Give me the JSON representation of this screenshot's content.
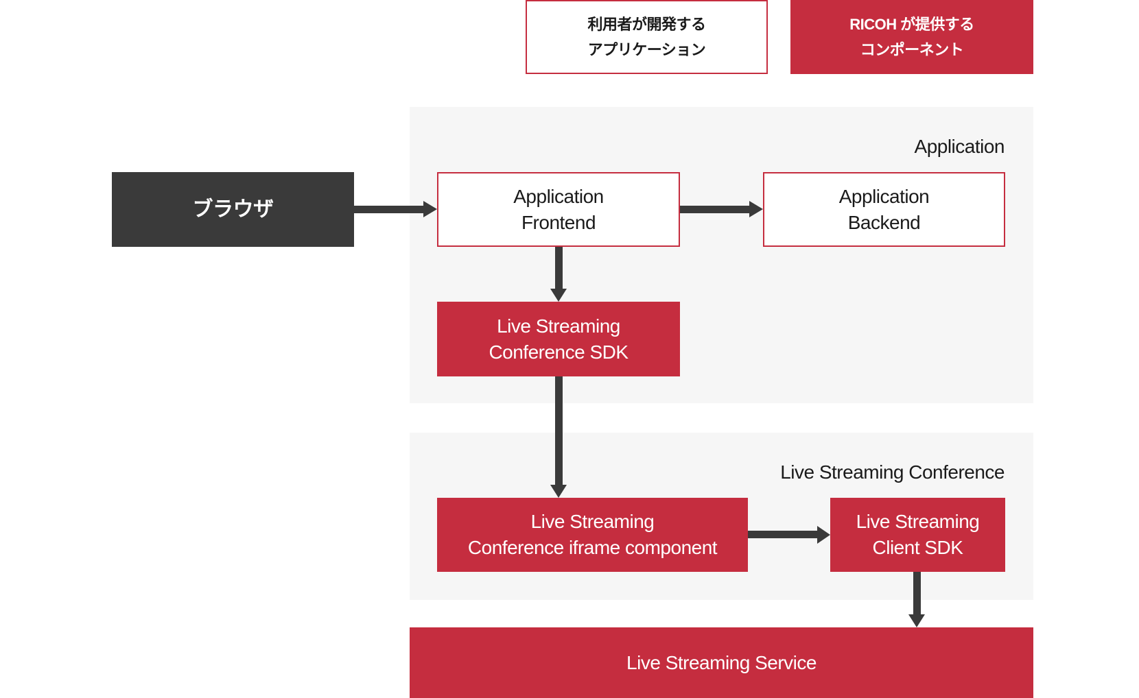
{
  "legend": {
    "user_app": "利用者が開発する\nアプリケーション",
    "ricoh_component": "RICOH が提供する\nコンポーネント"
  },
  "panels": {
    "application": "Application",
    "live_streaming_conference": "Live Streaming Conference"
  },
  "nodes": {
    "browser": "ブラウザ",
    "frontend": "Application\nFrontend",
    "backend": "Application\nBackend",
    "conference_sdk": "Live Streaming\nConference SDK",
    "iframe_component": "Live Streaming\nConference iframe component",
    "client_sdk": "Live Streaming\nClient SDK",
    "service": "Live Streaming Service"
  },
  "colors": {
    "ricoh_red": "#c52d3f",
    "browser": "#3a3a3a",
    "panel": "#f6f6f6",
    "arrow": "#3a3a3a"
  }
}
